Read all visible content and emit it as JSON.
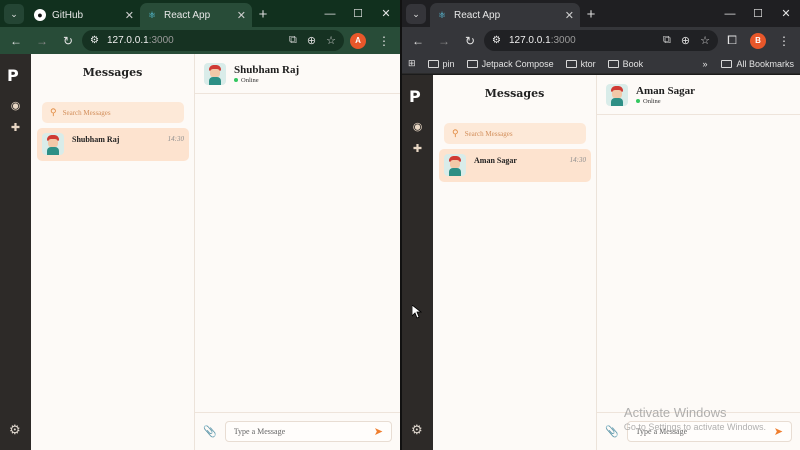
{
  "left_window": {
    "tabs": [
      {
        "label": "GitHub",
        "icon": "github-icon"
      },
      {
        "label": "React App",
        "icon": "react-icon",
        "active": true
      }
    ],
    "url_host": "127.0.0.1",
    "url_path": ":3000",
    "profile_initial": "A",
    "profile_color": "#e8572a",
    "theme_color": "#284c38",
    "app": {
      "list_title": "Messages",
      "search_placeholder": "Search Messages",
      "conversation": {
        "name": "Shubham Raj",
        "time": "14:30"
      },
      "chat_header": {
        "name": "Shubham Raj",
        "status": "Online"
      },
      "compose_placeholder": "Type a Message"
    }
  },
  "right_window": {
    "tabs": [
      {
        "label": "React App",
        "icon": "react-icon",
        "active": true
      }
    ],
    "url_host": "127.0.0.1",
    "url_path": ":3000",
    "profile_initial": "B",
    "profile_color": "#e8572a",
    "theme_color": "#35363a",
    "bookmarks": [
      "pin",
      "Jetpack Compose",
      "ktor",
      "Book"
    ],
    "all_bookmarks_label": "All Bookmarks",
    "app": {
      "list_title": "Messages",
      "search_placeholder": "Search Messages",
      "conversation": {
        "name": "Aman Sagar",
        "time": "14:30"
      },
      "chat_header": {
        "name": "Aman Sagar",
        "status": "Online"
      },
      "compose_placeholder": "Type a Message"
    },
    "watermark": {
      "line1": "Activate Windows",
      "line2": "Go to Settings to activate Windows."
    }
  },
  "colors": {
    "accent": "#ef7d2d",
    "search_bg": "#fde9d8",
    "selected_conv_bg": "#fde3cf",
    "rail_bg": "#2d2a28",
    "online": "#33c760"
  }
}
